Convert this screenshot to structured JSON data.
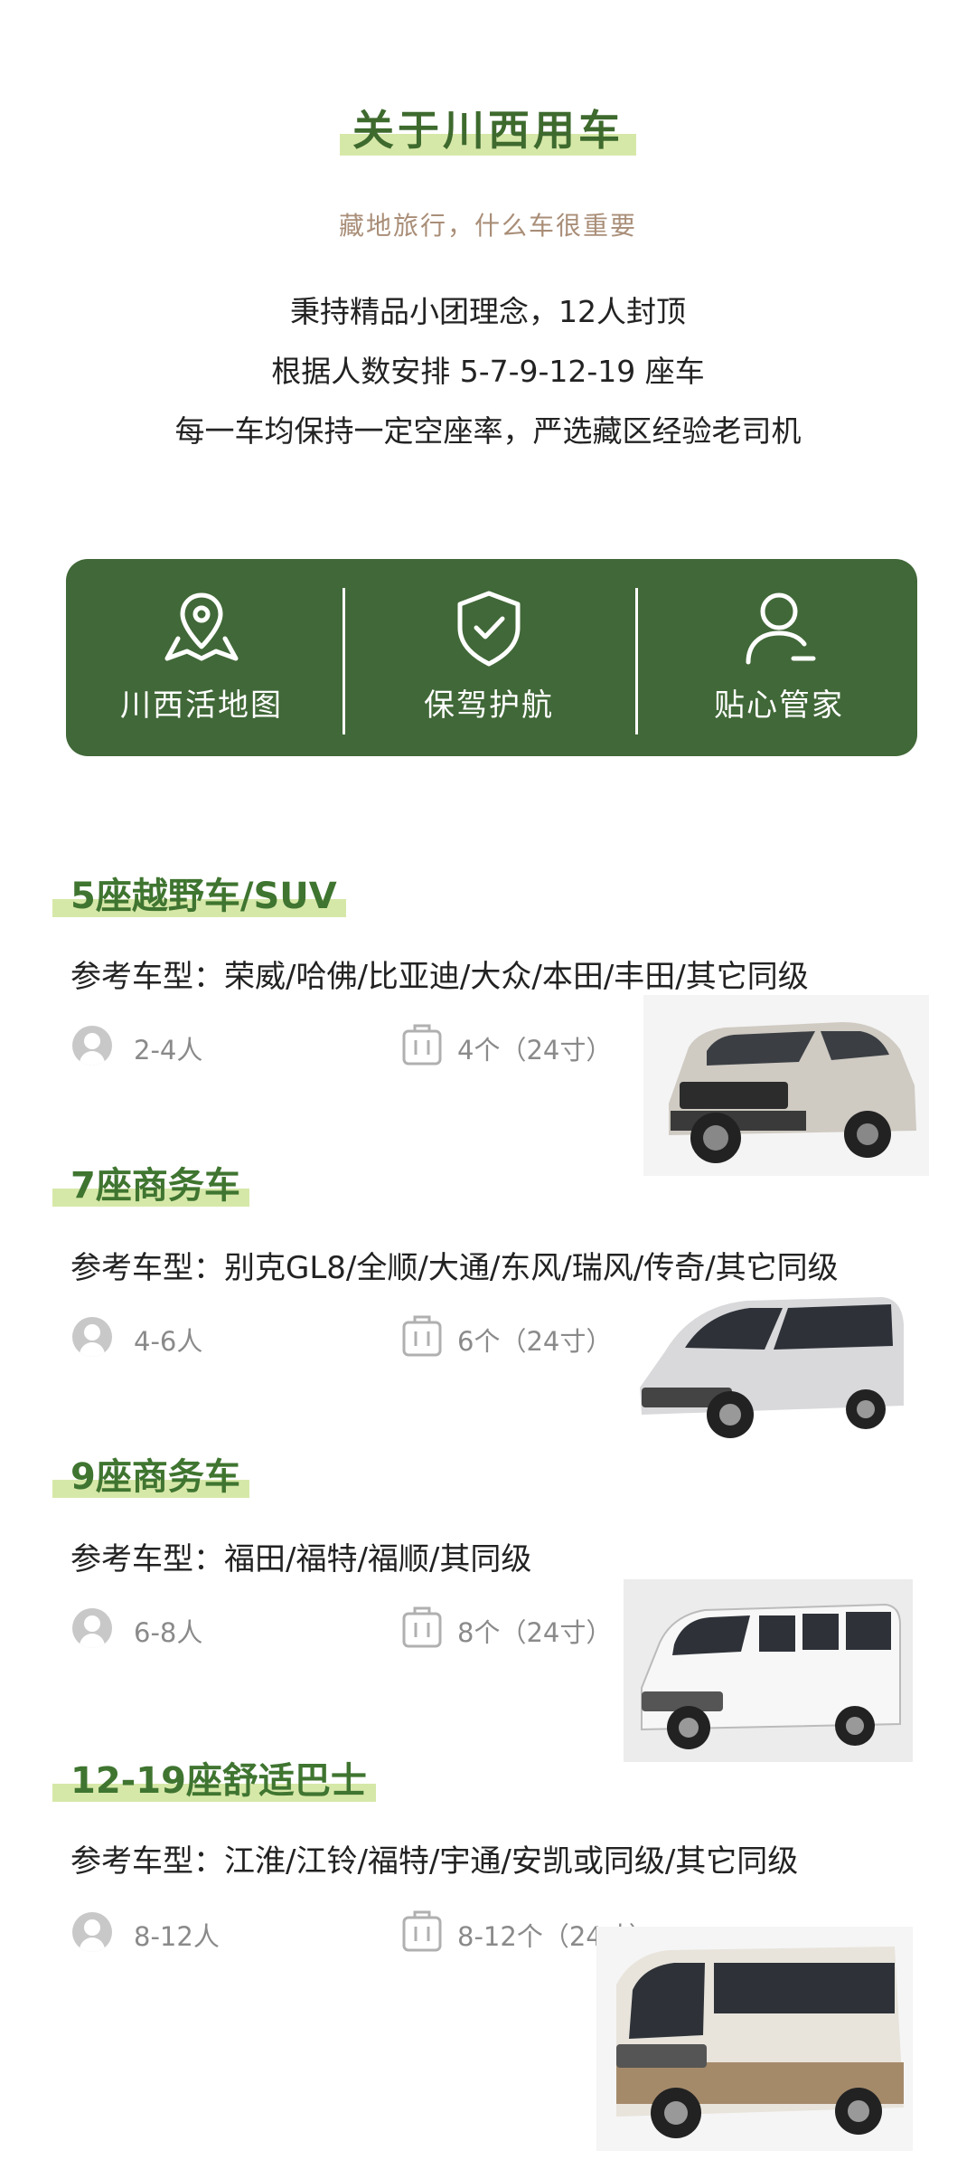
{
  "header": {
    "title": "关于川西用车",
    "subtitle": "藏地旅行，什么车很重要",
    "intro": [
      "秉持精品小团理念，12人封顶",
      "根据人数安排 5-7-9-12-19 座车",
      "每一车均保持一定空座率，严选藏区经验老司机"
    ]
  },
  "features": [
    {
      "label": "川西活地图",
      "icon": "map-pin-icon"
    },
    {
      "label": "保驾护航",
      "icon": "shield-check-icon"
    },
    {
      "label": "贴心管家",
      "icon": "user-icon"
    }
  ],
  "vehicles": [
    {
      "title": "5座越野车/SUV",
      "models": "参考车型：荣威/哈佛/比亚迪/大众/本田/丰田/其它同级",
      "people": "2-4人",
      "luggage": "4个（24寸）",
      "image": "suv"
    },
    {
      "title": "7座商务车",
      "models": "参考车型：别克GL8/全顺/大通/东风/瑞风/传奇/其它同级",
      "people": "4-6人",
      "luggage": "6个（24寸）",
      "image": "mpv"
    },
    {
      "title": "9座商务车",
      "models": "参考车型：福田/福特/福顺/其同级",
      "people": "6-8人",
      "luggage": "8个（24寸）",
      "image": "van"
    },
    {
      "title": "12-19座舒适巴士",
      "models": "参考车型：江淮/江铃/福特/宇通/安凯或同级/其它同级",
      "people": "8-12人",
      "luggage": "8-12个（24寸）",
      "image": "bus"
    }
  ],
  "colors": {
    "primary": "#416838",
    "title_green": "#3f7530",
    "highlight": "#d6e8a8",
    "subtitle": "#a98e78"
  }
}
